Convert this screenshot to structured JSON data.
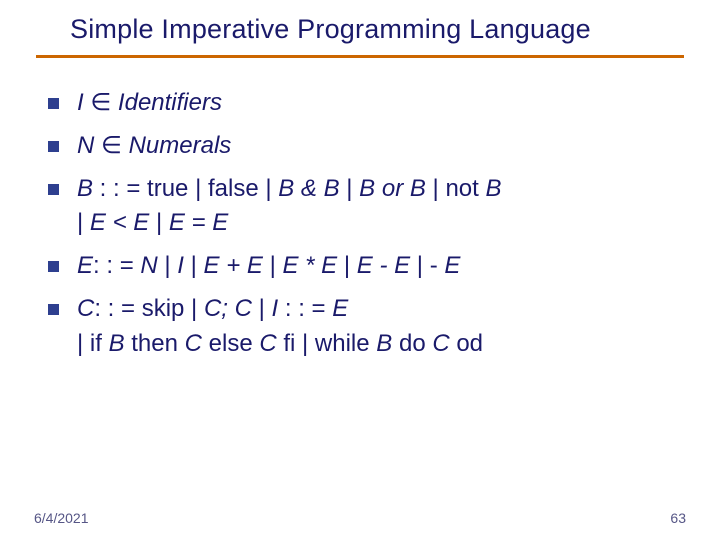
{
  "title": "Simple Imperative Programming Language",
  "bullets": {
    "b1": {
      "I": "I",
      "in": "∈",
      "Identifiers": "Identifiers"
    },
    "b2": {
      "N": "N",
      "in": "∈",
      "Numerals": "Numerals"
    },
    "b3": {
      "B": "B",
      "def": " : : = true | false | ",
      "BandB": "B & B",
      "sep1": " | ",
      "BorB": "B or B",
      "sep2": " | not ",
      "Blast": "B",
      "line2_pre": "| ",
      "EltE": "E < E",
      "sep3": " | ",
      "EeqE": "E = E"
    },
    "b4": {
      "E": "E",
      "def": ": : = ",
      "N": "N",
      "s1": " | ",
      "I": "I",
      "s2": " | ",
      "EpE": "E + E",
      "s3": " | ",
      "EtE": "E * E",
      "s4": " | ",
      "EmE": "E - E",
      "s5": " | - ",
      "Eneg": "E"
    },
    "b5": {
      "C": "C",
      "def": ": : = skip | ",
      "CsemiC": "C; C",
      "s1": " | ",
      "I": "I",
      "assign": " : : = ",
      "E": "E",
      "line2_pre": "| if ",
      "B": "B",
      "then": " then ",
      "C1": "C ",
      "else": "else ",
      "C2": "C ",
      "fi": "fi | while ",
      "B2": "B",
      "do": " do ",
      "C3": "C ",
      "od": "od"
    }
  },
  "footer": {
    "date": "6/4/2021",
    "page": "63"
  }
}
